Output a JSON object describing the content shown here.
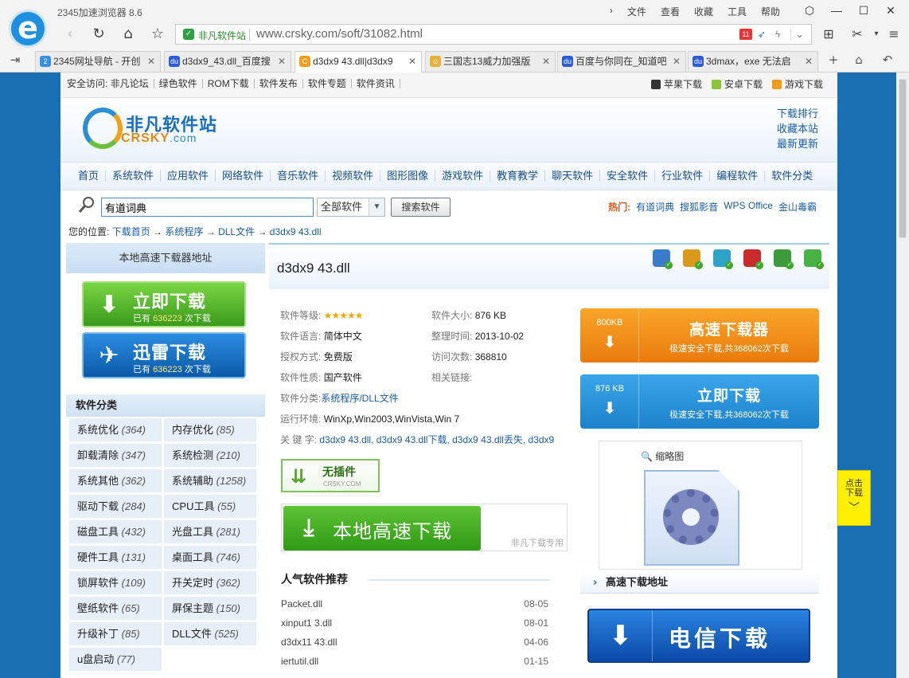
{
  "browser": {
    "app_title": "2345加速浏览器 8.6",
    "menu": [
      "文件",
      "查看",
      "收藏",
      "工具",
      "帮助"
    ],
    "site_badge": "非凡软件站",
    "url": "www.crsky.com/soft/31082.html",
    "tabs": [
      {
        "title": "2345网址导航 - 开创",
        "active": false
      },
      {
        "title": "d3dx9_43.dll_百度搜",
        "active": false
      },
      {
        "title": "d3dx9 43.dll|d3dx9",
        "active": true
      },
      {
        "title": "三国志13威力加强版",
        "active": false
      },
      {
        "title": "百度与你同在_知道吧",
        "active": false
      },
      {
        "title": "3dmax，exe 无法启",
        "active": false
      }
    ]
  },
  "site": {
    "toplinks": [
      "安全访问: 非凡论坛",
      "绿色软件",
      "ROM下载",
      "软件发布",
      "软件专题",
      "软件资讯"
    ],
    "topright": [
      "苹果下载",
      "安卓下载",
      "游戏下载"
    ],
    "brand_cn": "非凡软件站",
    "brand_en": "CRSKY",
    "brand_domain": ".com",
    "header_links": [
      "下载排行",
      "收藏本站",
      "最新更新"
    ],
    "nav": [
      "首页",
      "系统软件",
      "应用软件",
      "网络软件",
      "音乐软件",
      "视频软件",
      "图形图像",
      "游戏软件",
      "教育教学",
      "聊天软件",
      "安全软件",
      "行业软件",
      "编程软件",
      "软件分类"
    ],
    "search_value": "有道词典",
    "search_scope": "全部软件",
    "search_button": "搜索软件",
    "hot_label": "热门:",
    "hot_items": [
      "有道词典",
      "搜狐影音",
      "WPS Office",
      "金山毒霸"
    ],
    "crumb_label": "您的位置:",
    "crumb": [
      "下载首页",
      "系统程序",
      "DLL文件",
      "d3dx9 43.dll"
    ],
    "crumb_arrow": "→"
  },
  "left": {
    "header": "本地高速下载器地址",
    "btn1_title": "立即下载",
    "btn2_title": "迅雷下载",
    "count_prefix": "已有",
    "count": "636223",
    "count_suffix": "次下载",
    "cat_header": "软件分类",
    "categories": [
      {
        "name": "系统优化",
        "count": "(364)"
      },
      {
        "name": "内存优化",
        "count": "(85)"
      },
      {
        "name": "卸载清除",
        "count": "(347)"
      },
      {
        "name": "系统检测",
        "count": "(210)"
      },
      {
        "name": "系统其他",
        "count": "(362)"
      },
      {
        "name": "系统辅助",
        "count": "(1258)"
      },
      {
        "name": "驱动下载",
        "count": "(284)"
      },
      {
        "name": "CPU工具",
        "count": "(55)"
      },
      {
        "name": "磁盘工具",
        "count": "(432)"
      },
      {
        "name": "光盘工具",
        "count": "(281)"
      },
      {
        "name": "硬件工具",
        "count": "(131)"
      },
      {
        "name": "桌面工具",
        "count": "(746)"
      },
      {
        "name": "锁屏软件",
        "count": "(109)"
      },
      {
        "name": "开关定时",
        "count": "(362)"
      },
      {
        "name": "壁纸软件",
        "count": "(65)"
      },
      {
        "name": "屏保主题",
        "count": "(150)"
      },
      {
        "name": "升级补丁",
        "count": "(85)"
      },
      {
        "name": "DLL文件",
        "count": "(525)"
      },
      {
        "name": "u盘启动",
        "count": "(77)"
      }
    ]
  },
  "detail": {
    "title": "d3dx9 43.dll",
    "rating_label": "软件等级:",
    "rating_stars": "★★★★★",
    "size_label": "软件大小:",
    "size": "876 KB",
    "lang_label": "软件语言:",
    "lang": "简体中文",
    "date_label": "整理时间:",
    "date": "2013-10-02",
    "license_label": "授权方式:",
    "license": "免费版",
    "visits_label": "访问次数:",
    "visits": "368810",
    "nature_label": "软件性质:",
    "nature": "国产软件",
    "related_label": "相关链接:",
    "category_label": "软件分类:",
    "category": "系统程序/DLL文件",
    "env_label": "运行环境:",
    "env": "WinXp,Win2003,WinVista,Win 7",
    "keywords_label": "关 键 字:",
    "keywords": "d3dx9 43.dll, d3dx9 43.dll下载, d3dx9 43.dll丢失, d3dx9",
    "noplugin": "无插件",
    "noplugin_sub": "CRSKY.COM",
    "local_dl": "本地高速下载",
    "local_note": "非凡下载专用",
    "popular_header": "人气软件推荐",
    "popular": [
      {
        "name": "Packet.dll",
        "date": "08-05"
      },
      {
        "name": "xinput1 3.dll",
        "date": "08-01"
      },
      {
        "name": "d3dx11 43.dll",
        "date": "04-06"
      },
      {
        "name": "iertutil.dll",
        "date": "01-15"
      }
    ]
  },
  "right": {
    "dl1_size": "800KB",
    "dl1_title": "高速下载器",
    "dl1_sub": "极速安全下载,共368062次下载",
    "dl2_size": "876 KB",
    "dl2_title": "立即下载",
    "dl2_sub": "极速安全下载,共368062次下载",
    "thumb_label": "缩略图",
    "hs_label": "高速下载地址",
    "telecom": "电信下载"
  },
  "float": {
    "line1": "点击",
    "line2": "下载"
  },
  "colors": {
    "page_bg": "#1a6fb3",
    "link": "#1b5ea8",
    "orange_btn": "#f39a1c",
    "blue_btn": "#2b94dd",
    "green_btn": "#4cb02a"
  }
}
